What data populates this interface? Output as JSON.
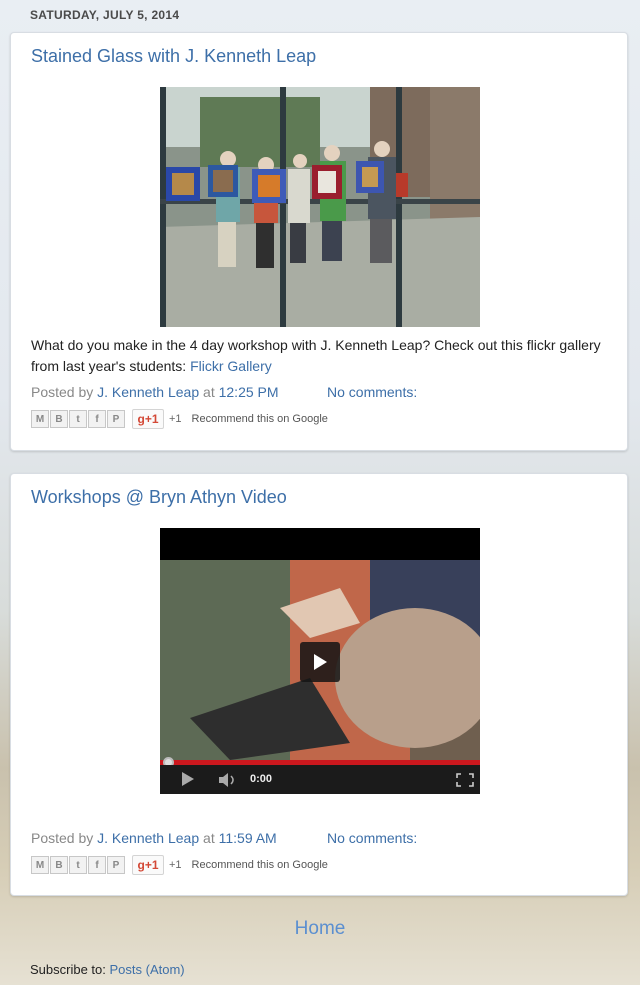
{
  "date_header": "SATURDAY, JULY 5, 2014",
  "colors": {
    "link": "#3d6fa8",
    "progress_red": "#cc181e",
    "home_link": "#5b8fd0"
  },
  "posts": [
    {
      "title": "Stained Glass with J. Kenneth Leap",
      "body_text": "What do you make in the 4 day workshop with J. Kenneth Leap? Check out this flickr gallery from last year's students: ",
      "body_link": "Flickr Gallery",
      "posted_by_label": "Posted by",
      "author": "J. Kenneth Leap",
      "at_label": "at",
      "time": "12:25 PM",
      "comments": "No comments:"
    },
    {
      "title": "Workshops @ Bryn Athyn Video",
      "video": {
        "time": "0:00",
        "progress": 0.0
      },
      "posted_by_label": "Posted by",
      "author": "J. Kenneth Leap",
      "at_label": "at",
      "time": "11:59 AM",
      "comments": "No comments:"
    }
  ],
  "share": {
    "icons": [
      "email-icon",
      "blogger-icon",
      "twitter-icon",
      "facebook-icon",
      "pinterest-icon"
    ],
    "gplus_label": "g+1",
    "plus_count": "+1",
    "recommend": "Recommend this on Google"
  },
  "footer": {
    "home": "Home",
    "subscribe_label": "Subscribe to:",
    "subscribe_link": "Posts (Atom)"
  }
}
